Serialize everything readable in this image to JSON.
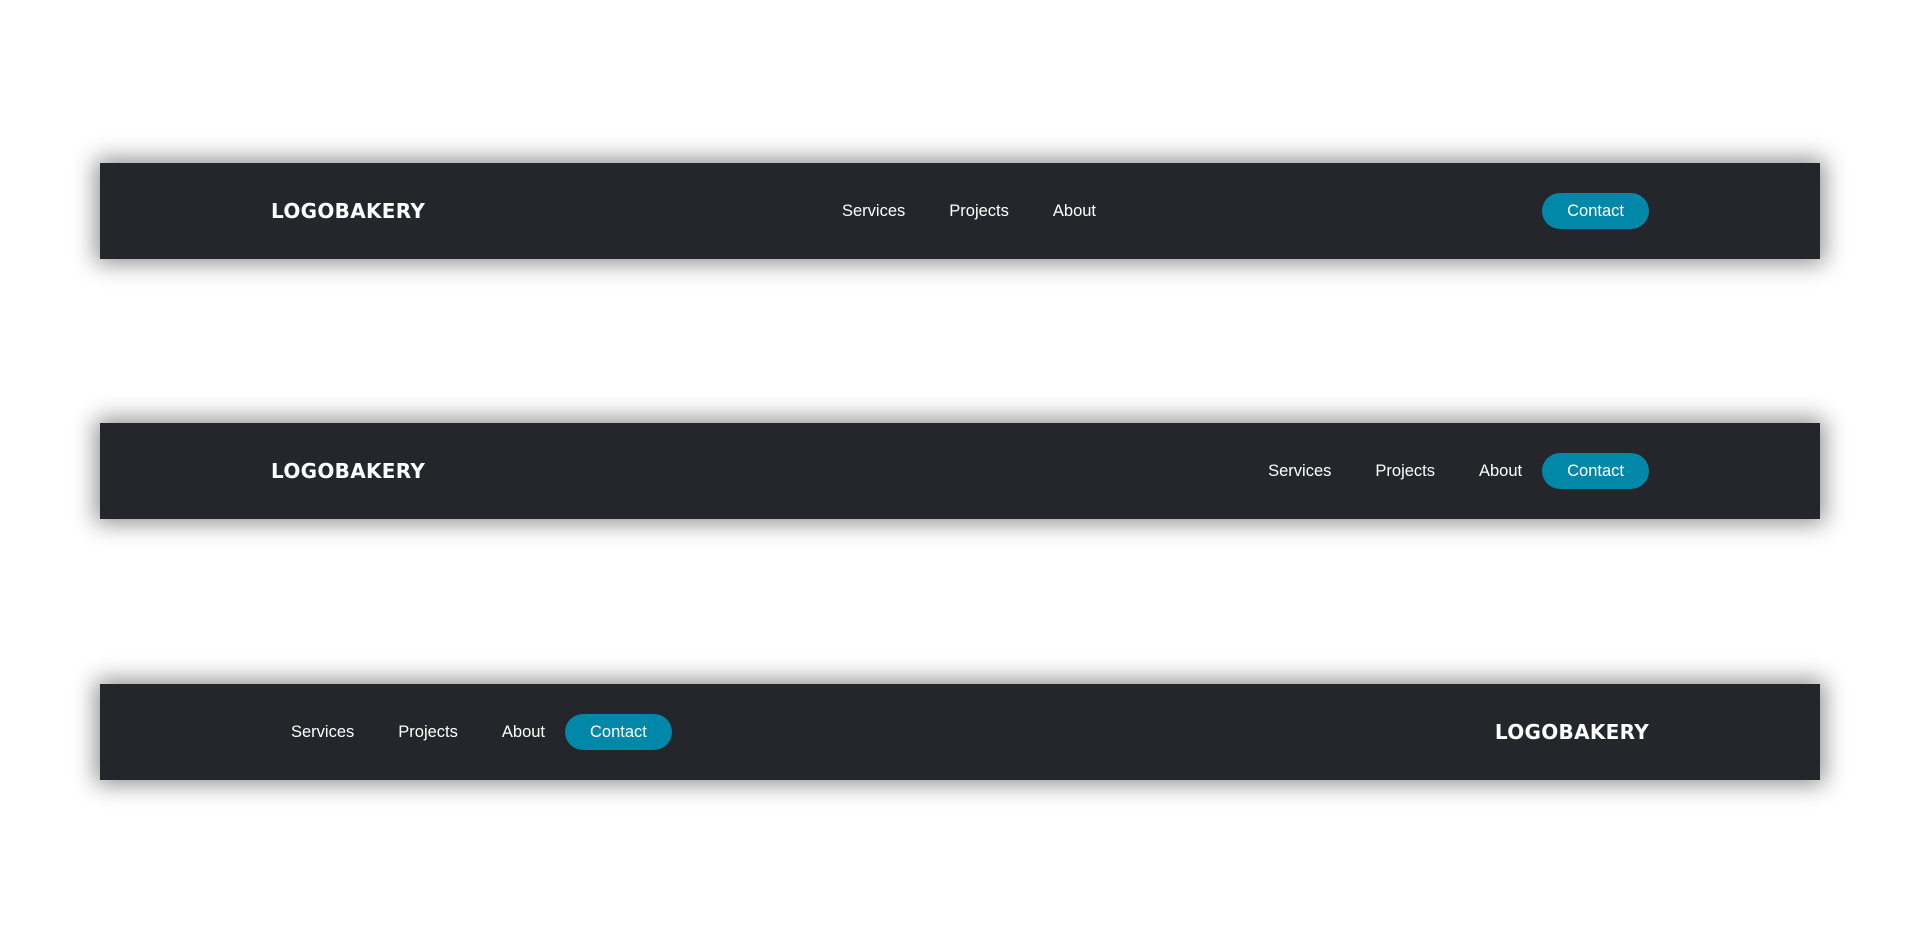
{
  "brand": {
    "logo_text": "LOGOBAKERY",
    "accent_color": "#0187a7",
    "navbar_color": "#25262b"
  },
  "nav": {
    "services": "Services",
    "projects": "Projects",
    "about": "About",
    "contact": "Contact"
  }
}
